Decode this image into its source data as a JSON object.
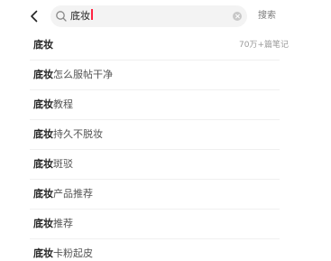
{
  "search": {
    "query": "底妆",
    "button_label": "搜索"
  },
  "suggestions": [
    {
      "keyword": "底妆",
      "rest": "",
      "count": "70万+篇笔记"
    },
    {
      "keyword": "底妆",
      "rest": "怎么服帖干净"
    },
    {
      "keyword": "底妆",
      "rest": "教程"
    },
    {
      "keyword": "底妆",
      "rest": "持久不脱妆"
    },
    {
      "keyword": "底妆",
      "rest": "斑驳"
    },
    {
      "keyword": "底妆",
      "rest": "产品推荐"
    },
    {
      "keyword": "底妆",
      "rest": "推荐"
    },
    {
      "keyword": "底妆",
      "rest": "卡粉起皮"
    }
  ],
  "colors": {
    "caret": "#ff2442",
    "search_bg": "#f3f3f3",
    "muted_text": "#999999"
  }
}
